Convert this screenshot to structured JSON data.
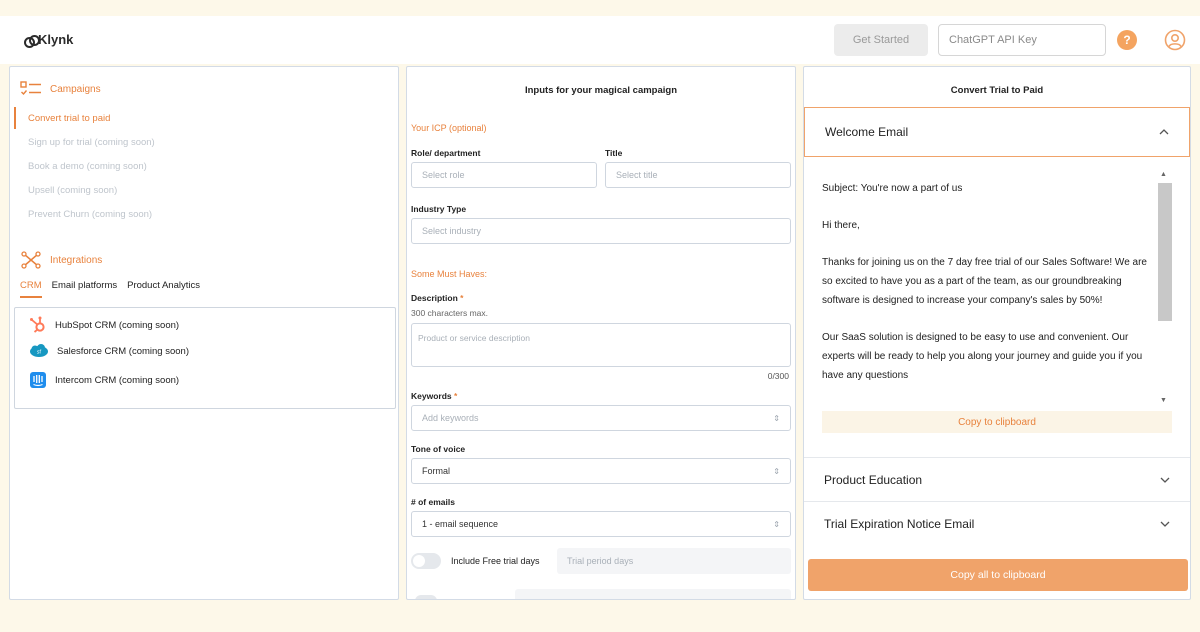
{
  "app": {
    "logo_text": "Klynk"
  },
  "header": {
    "get_started_label": "Get Started",
    "api_key_placeholder": "ChatGPT API Key",
    "help_glyph": "?"
  },
  "campaigns": {
    "title": "Campaigns",
    "items": [
      {
        "label": "Convert trial to paid",
        "active": true
      },
      {
        "label": "Sign up for trial (coming soon)",
        "active": false
      },
      {
        "label": "Book a demo (coming soon)",
        "active": false
      },
      {
        "label": "Upsell (coming soon)",
        "active": false
      },
      {
        "label": "Prevent Churn (coming soon)",
        "active": false
      }
    ]
  },
  "integrations": {
    "title": "Integrations",
    "tabs": [
      "CRM",
      "Email platforms",
      "Product Analytics"
    ],
    "active_tab": "CRM",
    "items": [
      {
        "label": "HubSpot CRM (coming soon)",
        "icon": "hubspot-icon",
        "color": "#ff7a59"
      },
      {
        "label": "Salesforce CRM (coming soon)",
        "icon": "salesforce-icon",
        "color": "#1798c1"
      },
      {
        "label": "Intercom CRM (coming soon)",
        "icon": "intercom-icon",
        "color": "#1f8ded"
      }
    ]
  },
  "inputs": {
    "title": "Inputs for your magical campaign",
    "icp_label": "Your ICP (optional)",
    "role_label": "Role/ department",
    "role_placeholder": "Select role",
    "title_label": "Title",
    "title_placeholder": "Select title",
    "industry_label": "Industry Type",
    "industry_placeholder": "Select industry",
    "must_haves_label": "Some Must Haves:",
    "description_label": "Description",
    "required_mark": "*",
    "description_note": "300 characters max.",
    "description_placeholder": "Product or service description",
    "description_counter": "0/300",
    "keywords_label": "Keywords",
    "keywords_placeholder": "Add keywords",
    "tone_label": "Tone of voice",
    "tone_value": "Formal",
    "emails_label": "# of emails",
    "emails_value": "1 - email sequence",
    "free_trial_label": "Include Free trial days",
    "trial_period_placeholder": "Trial period days",
    "arrows_glyph": "⇕"
  },
  "output": {
    "title": "Convert Trial to Paid",
    "open_email": {
      "title": "Welcome Email",
      "paragraphs": [
        "Subject: You're now a part of us",
        "Hi there,",
        "Thanks for joining us on the 7 day free trial of our Sales Software! We are so excited to have you as a part of the team, as our groundbreaking software is designed to increase your company's sales by 50%!",
        "Our SaaS solution is designed to be easy to use and convenient. Our experts will be ready to help you along your journey and guide you if you have any questions"
      ],
      "copy_label": "Copy to clipboard"
    },
    "collapsed": [
      {
        "title": "Product Education"
      },
      {
        "title": "Trial Expiration Notice Email"
      }
    ],
    "copy_all_label": "Copy all to clipboard",
    "accent_color": "#e8823d"
  }
}
